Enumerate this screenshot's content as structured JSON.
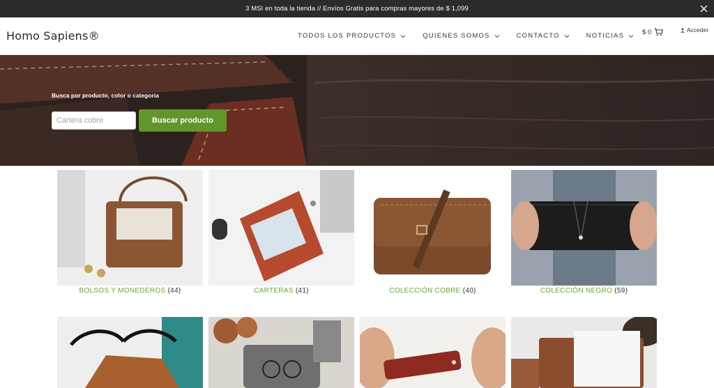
{
  "announcement": {
    "text": "3 MSI en toda la tienda // Envíos Gratis para compras mayores de $ 1,099",
    "close_icon": "close-icon"
  },
  "header": {
    "logo": "Homo Sapiens®",
    "nav": [
      {
        "label": "TODOS LOS PRODUCTOS"
      },
      {
        "label": "QUIENES SOMOS"
      },
      {
        "label": "CONTACTO"
      },
      {
        "label": "NOTICIAS"
      }
    ],
    "cart": {
      "amount": "$ 0",
      "icon": "cart-icon"
    },
    "login": {
      "label": "Acceder",
      "icon": "user-icon"
    }
  },
  "hero": {
    "label": "Busca por producto, color o categoria",
    "input_placeholder": "Cartera cobre",
    "button_label": "Buscar producto"
  },
  "categories": [
    {
      "name": "BOLSOS Y MONEDEROS",
      "count": "(44)"
    },
    {
      "name": "CARTERAS",
      "count": "(41)"
    },
    {
      "name": "COLECCIÓN COBRE",
      "count": "(40)"
    },
    {
      "name": "COLECCIÓN NEGRO",
      "count": "(59)"
    },
    {
      "name": "",
      "count": ""
    },
    {
      "name": "",
      "count": ""
    },
    {
      "name": "",
      "count": ""
    },
    {
      "name": "",
      "count": ""
    }
  ],
  "colors": {
    "announcement_bg": "#2b2b2b",
    "accent_green": "#61962b",
    "category_text": "#6ea233"
  }
}
